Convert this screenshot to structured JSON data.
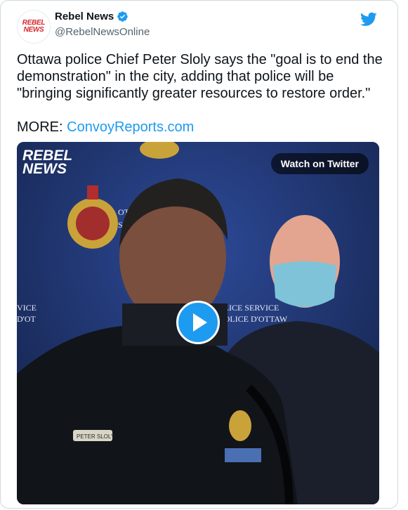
{
  "account": {
    "name": "Rebel News",
    "handle": "@RebelNewsOnline",
    "avatar_text_line1": "REBEL",
    "avatar_text_line2": "NEWS"
  },
  "tweet": {
    "text": "Ottawa police Chief Peter Sloly says the \"goal is to end the demonstration\" in the city, adding that police will be \"bringing significantly greater resources to restore order.\"",
    "more_label": "MORE: ",
    "more_link": "ConvoyReports.com"
  },
  "video": {
    "watch_label": "Watch on Twitter",
    "logo_line1": "REBEL",
    "logo_line2": "NEWS",
    "nameplate": "PETER SLOLY",
    "backdrop_text_1": "VICE",
    "backdrop_text_2": "D'OT",
    "backdrop_text_3": "OLICE SERVICE",
    "backdrop_text_4": "POLICE D'OTTAW",
    "backdrop_text_5": "OT",
    "backdrop_text_6": "SI"
  },
  "colors": {
    "accent": "#1d9bf0",
    "text": "#0f1419",
    "muted": "#536471",
    "border": "#cfd9de",
    "brand_red": "#d7262c"
  }
}
